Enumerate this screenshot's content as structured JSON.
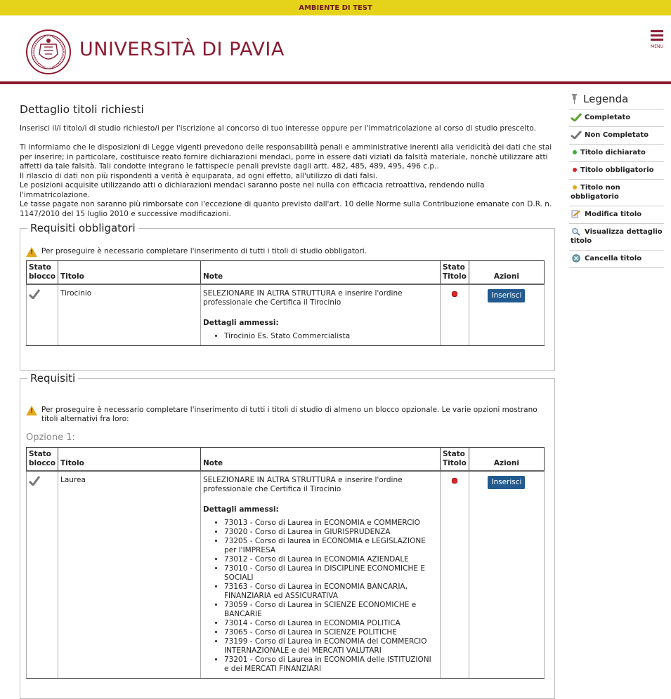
{
  "env_banner": "AMBIENTE DI TEST",
  "header": {
    "logo_text": "UNIVERSITÀ DI PAVIA",
    "menu_label": "MENU"
  },
  "page": {
    "title": "Dettaglio titoli richiesti",
    "intro": "Inserisci il/i titolo/i di studio richiesto/i per l'iscrizione al concorso di tuo interesse oppure per l'immatricolazione al corso di studio prescelto.",
    "disclaimer": [
      "Ti informiamo che le disposizioni di Legge vigenti prevedono delle responsabilità penali e amministrative inerenti alla veridicità dei dati che stai per inserire; in particolare, costituisce reato fornire dichiarazioni mendaci, porre in essere dati viziati da falsità materiale, nonchè utilizzare atti affetti da tale falsità. Tali condotte integrano le fattispecie penali previste dagli artt. 482, 485, 489, 495, 496 c.p..",
      "Il rilascio di dati non più rispondenti a verità è equiparata, ad ogni effetto, all'utilizzo di dati falsi.",
      "Le posizioni acquisite utilizzando atti o dichiarazioni mendaci saranno poste nel nulla con efficacia retroattiva, rendendo nulla l'immatricolazione.",
      "Le tasse pagate non saranno più rimborsate con l'eccezione di quanto previsto dall'art. 10 delle Norme sulla Contribuzione emanate con D.R. n. 1147/2010 del 15 luglio 2010 e successive modificazioni."
    ]
  },
  "columns": {
    "stato_blocco": "Stato blocco",
    "titolo": "Titolo",
    "note": "Note",
    "stato_titolo": "Stato Titolo",
    "azioni": "Azioni"
  },
  "obbligatori": {
    "legend": "Requisiti obbligatori",
    "warning": "Per proseguire è necessario completare l'inserimento di tutti i titoli di studio obbligatori.",
    "row": {
      "titolo": "Tirocinio",
      "note": "SELEZIONARE IN ALTRA STRUTTURA e inserire l'ordine professionale che Certifica il Tirocinio",
      "ammessi_title": "Dettagli ammessi:",
      "ammessi": [
        "Tirocinio Es. Stato Commercialista"
      ],
      "action": "Inserisci"
    }
  },
  "requisiti": {
    "legend": "Requisiti",
    "warning": "Per proseguire è necessario completare l'inserimento di tutti i titoli di studio di almeno un blocco opzionale. Le varie opzioni mostrano titoli alternativi fra loro:",
    "option_label": "Opzione 1:",
    "row": {
      "titolo": "Laurea",
      "note": "SELEZIONARE IN ALTRA STRUTTURA e inserire l'ordine professionale che Certifica il Tirocinio",
      "ammessi_title": "Dettagli ammessi:",
      "ammessi": [
        "73013 - Corso di Laurea in ECONOMIA e COMMERCIO",
        "73020 - Corso di Laurea in GIURISPRUDENZA",
        "73205 - Corso di laurea in ECONOMIA e LEGISLAZIONE per l'IMPRESA",
        "73012 - Corso di Laurea in ECONOMIA AZIENDALE",
        "73010 - Corso di Laurea in DISCIPLINE ECONOMICHE E SOCIALI",
        "73163 - Corso di Laurea in ECONOMIA BANCARIA, FINANZIARIA ed ASSICURATIVA",
        "73059 - Corso di Laurea in SCIENZE ECONOMICHE e BANCARIE",
        "73014 - Corso di Laurea in ECONOMIA POLITICA",
        "73065 - Corso di Laurea in SCIENZE POLITICHE",
        "73199 - Corso di Laurea in ECONOMIA del COMMERCIO INTERNAZIONALE e dei MERCATI VALUTARI",
        "73201 - Corso di Laurea in ECONOMIA delle ISTITUZIONI e dei MERCATI FINANZIARI"
      ],
      "action": "Inserisci"
    }
  },
  "legenda": {
    "title": "Legenda",
    "items": [
      {
        "label": "Completato",
        "icon": "green-check-icon",
        "color": "#5aa02c"
      },
      {
        "label": "Non Completato",
        "icon": "gray-check-icon",
        "color": "#777777"
      },
      {
        "label": "Titolo dichiarato",
        "icon": "green-dot-icon",
        "color": "#3cae3c"
      },
      {
        "label": "Titolo obbligatorio",
        "icon": "red-dot-icon",
        "color": "#d6282b"
      },
      {
        "label": "Titolo non obbligatorio",
        "icon": "yellow-dot-icon",
        "color": "#e5a81b"
      },
      {
        "label": "Modifica titolo",
        "icon": "edit-icon"
      },
      {
        "label": "Visualizza dettaglio titolo",
        "icon": "magnifier-icon"
      },
      {
        "label": "Cancella titolo",
        "icon": "delete-icon"
      }
    ]
  }
}
